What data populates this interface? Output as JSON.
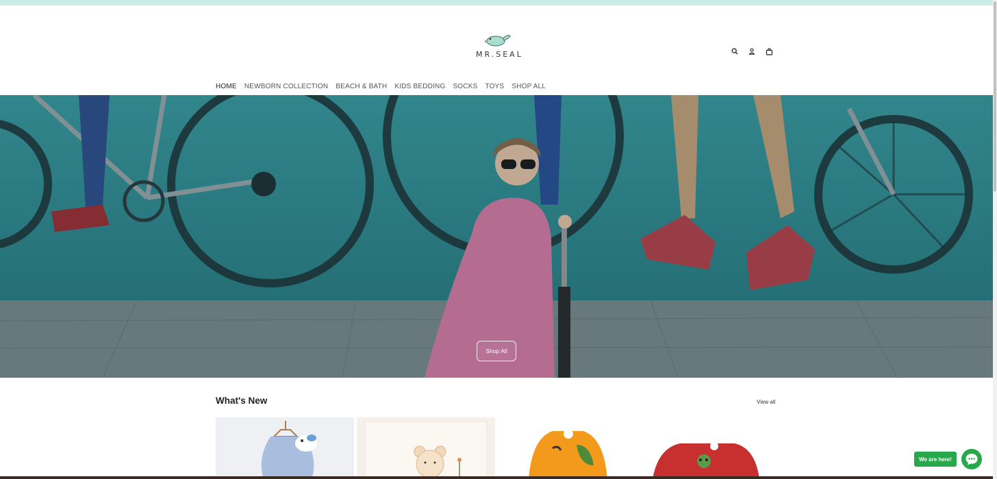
{
  "brand": {
    "name": "MR.SEAL"
  },
  "header": {
    "icons": [
      "search-icon",
      "account-icon",
      "cart-icon"
    ]
  },
  "nav": {
    "items": [
      {
        "label": "HOME"
      },
      {
        "label": "NEWBORN COLLECTION"
      },
      {
        "label": "BEACH & BATH"
      },
      {
        "label": "KIDS BEDDING"
      },
      {
        "label": "SOCKS"
      },
      {
        "label": "TOYS"
      },
      {
        "label": "SHOP ALL"
      }
    ]
  },
  "hero": {
    "button_label": "Shop All"
  },
  "whats_new": {
    "title": "What's New",
    "view_all_label": "View all"
  },
  "chat": {
    "label": "We are here!"
  },
  "colors": {
    "announcement_bar": "#c9ece6",
    "chat_accent": "#27a84a",
    "hero_teal": "#2f8d93"
  }
}
